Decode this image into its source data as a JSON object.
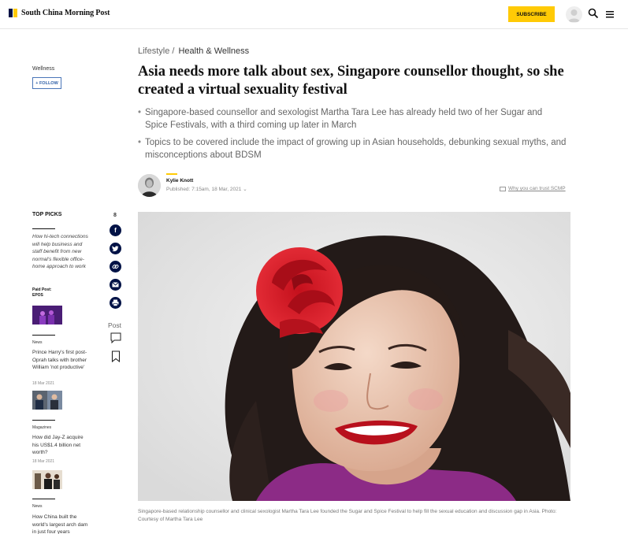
{
  "header": {
    "brand": "South China Morning Post",
    "subscribe_label": "SUBSCRIBE",
    "colors": {
      "brand_yellow": "#ffca05",
      "brand_blue": "#001246"
    }
  },
  "left": {
    "topic": "Wellness",
    "follow_label": "+ FOLLOW"
  },
  "breadcrumb": {
    "section": "Lifestyle /",
    "subsection": "Health & Wellness"
  },
  "article": {
    "headline": "Asia needs more talk about sex, Singapore counsellor thought, so she created a virtual sexuality festival",
    "summary": [
      "Singapore-based counsellor and sexologist Martha Tara Lee has already held two of her Sugar and Spice Festivals, with a third coming up later in March",
      "Topics to be covered include the impact of growing up in Asian households, debunking sexual myths, and misconceptions about BDSM"
    ],
    "author": "Kylie Knott",
    "published": "Published: 7:15am, 18 Mar, 2021",
    "trust_link": "Why you can trust SCMP",
    "caption": "Singapore-based relationship counsellor and clinical sexologist Martha Tara Lee founded the Sugar and Spice Festival to help fill the sexual education and discussion gap in Asia. Photo: Courtesy of Martha Tara Lee"
  },
  "social": {
    "share_count": "8",
    "icons": [
      "facebook-icon",
      "twitter-icon",
      "link-icon",
      "email-icon",
      "print-icon"
    ],
    "post_label": "Post"
  },
  "top_picks": {
    "title": "TOP PICKS",
    "items": [
      {
        "headline": "How hi-tech connections will help business and staff benefit from new normal's flexible office-home approach to work",
        "paid_label": "Paid Post:",
        "sponsor": "EPOS"
      },
      {
        "section": "News",
        "headline": "Prince Harry's first post-Oprah talks with brother William 'not productive'",
        "date": "18 Mar 2021"
      },
      {
        "section": "Magazines",
        "headline": "How did Jay-Z acquire his US$1.4 billion net worth?",
        "date": "18 Mar 2021"
      },
      {
        "section": "News",
        "headline": "How China built the world's largest arch dam in just four years"
      }
    ]
  }
}
